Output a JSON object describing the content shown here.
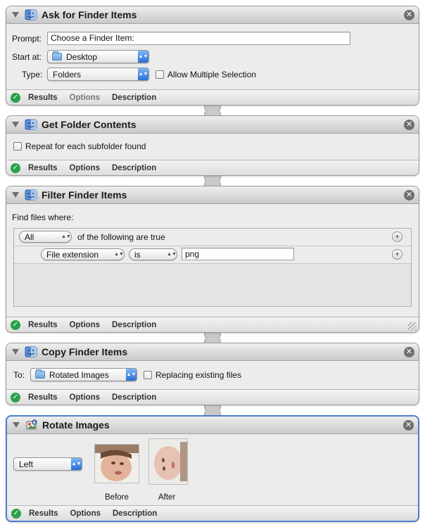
{
  "actions": {
    "ask": {
      "title": "Ask for Finder Items",
      "prompt_label": "Prompt:",
      "prompt_value": "Choose a Finder Item:",
      "start_label": "Start at:",
      "start_value": "Desktop",
      "type_label": "Type:",
      "type_value": "Folders",
      "allow_multiple_label": "Allow Multiple Selection",
      "allow_multiple_checked": false
    },
    "get_contents": {
      "title": "Get Folder Contents",
      "repeat_label": "Repeat for each subfolder found",
      "repeat_checked": false
    },
    "filter": {
      "title": "Filter Finder Items",
      "find_label": "Find files where:",
      "match_value": "All",
      "match_suffix": "of the following are true",
      "criterion_field": "File extension",
      "criterion_op": "is",
      "criterion_value": "png"
    },
    "copy": {
      "title": "Copy Finder Items",
      "to_label": "To:",
      "to_value": "Rotated Images",
      "replacing_label": "Replacing existing files",
      "replacing_checked": false
    },
    "rotate": {
      "title": "Rotate Images",
      "direction_value": "Left",
      "before_label": "Before",
      "after_label": "After"
    }
  },
  "footer": {
    "results": "Results",
    "options": "Options",
    "description": "Description"
  },
  "icons": {
    "close": "close-icon",
    "status": "check-icon",
    "disclosure": "disclosure-triangle-icon"
  },
  "colors": {
    "selected_border": "#4d7ed0",
    "status_ok": "#2aa14a",
    "popup_arrow": "#2c6fd6"
  }
}
